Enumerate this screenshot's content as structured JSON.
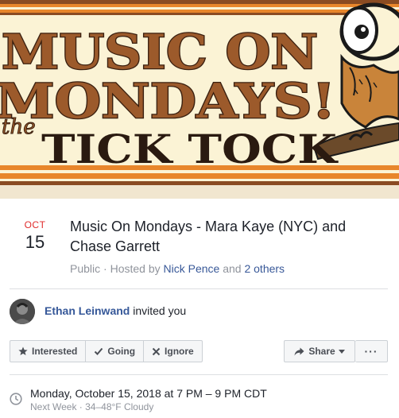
{
  "banner": {
    "line1": "MUSIC ON",
    "line2": "MONDAYS!",
    "line3_small": "the",
    "line3_big": "TICK TOCK",
    "colors": {
      "background": "#fbf3d5",
      "stripe_orange": "#e8862b",
      "stripe_brown": "#8a4b22",
      "text_fill": "#9c5a2b",
      "text_outline": "#3a2010"
    }
  },
  "event": {
    "month": "OCT",
    "day": "15",
    "title": "Music On Mondays - Mara Kaye (NYC) and Chase Garrett",
    "privacy": "Public",
    "hosted_by_prefix": "· Hosted by",
    "host_name": "Nick Pence",
    "and_text": "and",
    "others_link": "2 others"
  },
  "invite": {
    "inviter_name": "Ethan Leinwand",
    "invite_text": "invited you"
  },
  "actions": {
    "interested": "Interested",
    "going": "Going",
    "ignore": "Ignore",
    "share": "Share",
    "more": "···"
  },
  "time": {
    "datetime": "Monday, October 15, 2018 at 7 PM – 9 PM CDT",
    "weather": "Next Week · 34–48°F Cloudy"
  }
}
